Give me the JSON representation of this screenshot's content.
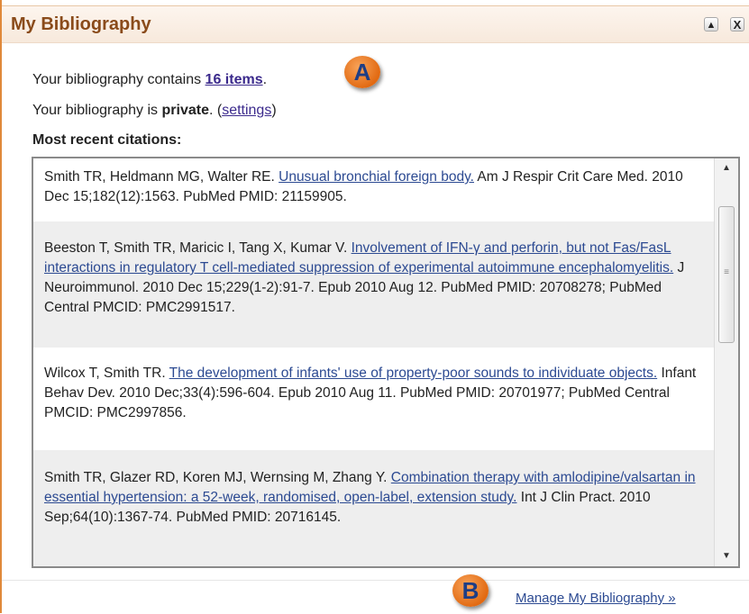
{
  "header": {
    "title": "My Bibliography",
    "collapse_icon": "▲",
    "close_icon": "X"
  },
  "summary": {
    "contains_prefix": "Your bibliography contains ",
    "count_link": "16 items",
    "contains_suffix": ".",
    "privacy_prefix": "Your bibliography is ",
    "privacy_value": "private",
    "privacy_mid": ". (",
    "settings_link": "settings",
    "privacy_suffix": ")",
    "recent_heading": "Most recent citations:"
  },
  "markers": {
    "a": "A",
    "b": "B"
  },
  "citations": [
    {
      "authors": "Smith TR, Heldmann MG, Walter RE. ",
      "title": "Unusual bronchial foreign body.",
      "rest": " Am J Respir Crit Care Med. 2010 Dec 15;182(12):1563. PubMed PMID: 21159905."
    },
    {
      "authors": "Beeston T, Smith TR, Maricic I, Tang X, Kumar V. ",
      "title": "Involvement of IFN-γ and perforin, but not Fas/FasL interactions in regulatory T cell-mediated suppression of experimental autoimmune encephalomyelitis.",
      "rest": " J Neuroimmunol. 2010 Dec 15;229(1-2):91-7. Epub 2010 Aug 12. PubMed PMID: 20708278; PubMed Central PMCID: PMC2991517."
    },
    {
      "authors": "Wilcox T, Smith TR. ",
      "title": "The development of infants' use of property-poor sounds to individuate objects.",
      "rest": " Infant Behav Dev. 2010 Dec;33(4):596-604. Epub 2010 Aug 11. PubMed PMID: 20701977; PubMed Central PMCID: PMC2997856."
    },
    {
      "authors": "Smith TR, Glazer RD, Koren MJ, Wernsing M, Zhang Y. ",
      "title": "Combination therapy with amlodipine/valsartan in essential hypertension: a 52-week, randomised, open-label, extension study.",
      "rest": " Int J Clin Pract. 2010 Sep;64(10):1367-74. PubMed PMID: 20716145."
    }
  ],
  "scrollbar": {
    "up_icon": "▲",
    "down_icon": "▼",
    "grip_icon": "≡"
  },
  "footer": {
    "manage_link": "Manage My Bibliography »"
  },
  "colors": {
    "header_title": "#8a4b1a",
    "link": "#2c4a92",
    "marker": "#e26a12",
    "panel_border": "#e0893a"
  }
}
